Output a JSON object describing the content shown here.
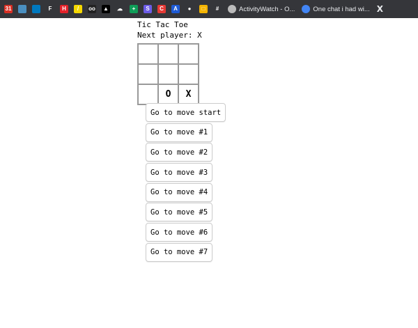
{
  "bookmarks": {
    "icons": [
      {
        "name": "calendar-icon",
        "color": "#d93025",
        "glyph": "31"
      },
      {
        "name": "maps-icon",
        "color": "#4a8fc0",
        "glyph": ""
      },
      {
        "name": "trello-icon",
        "color": "#0079bf",
        "glyph": ""
      },
      {
        "name": "f-logo-icon",
        "color": "#35363a",
        "glyph": "F"
      },
      {
        "name": "h-logo-icon",
        "color": "#e3222a",
        "glyph": "H"
      },
      {
        "name": "notes-icon",
        "color": "#f5d800",
        "glyph": "/"
      },
      {
        "name": "cloud-icon",
        "color": "#222",
        "glyph": "oo"
      },
      {
        "name": "triangle-icon",
        "color": "#000",
        "glyph": "▲"
      },
      {
        "name": "cloudflare-icon",
        "color": "#35363a",
        "glyph": "☁"
      },
      {
        "name": "sheets-icon",
        "color": "#0f9d58",
        "glyph": "+"
      },
      {
        "name": "s-logo-icon",
        "color": "#6c5ce7",
        "glyph": "S"
      },
      {
        "name": "c-logo-icon",
        "color": "#e53935",
        "glyph": "C"
      },
      {
        "name": "a-logo-icon",
        "color": "#1e5bd6",
        "glyph": "A"
      },
      {
        "name": "pin-icon",
        "color": "#35363a",
        "glyph": "●"
      },
      {
        "name": "square-logo-icon",
        "color": "#f4b400",
        "glyph": "□"
      },
      {
        "name": "slack-icon",
        "color": "#35363a",
        "glyph": "#"
      }
    ],
    "links": [
      {
        "label": "ActivityWatch - O...",
        "color": "#bbb"
      },
      {
        "label": "One chat i had wi...",
        "color": "#4285f4"
      }
    ],
    "x_label": "X"
  },
  "game": {
    "title": "Tic Tac Toe",
    "status": "Next player: X",
    "squares": [
      "",
      "",
      "",
      "",
      "",
      "",
      "",
      "O",
      "X"
    ],
    "moves": [
      "Go to move start",
      "Go to move #1",
      "Go to move #2",
      "Go to move #3",
      "Go to move #4",
      "Go to move #5",
      "Go to move #6",
      "Go to move #7"
    ]
  }
}
